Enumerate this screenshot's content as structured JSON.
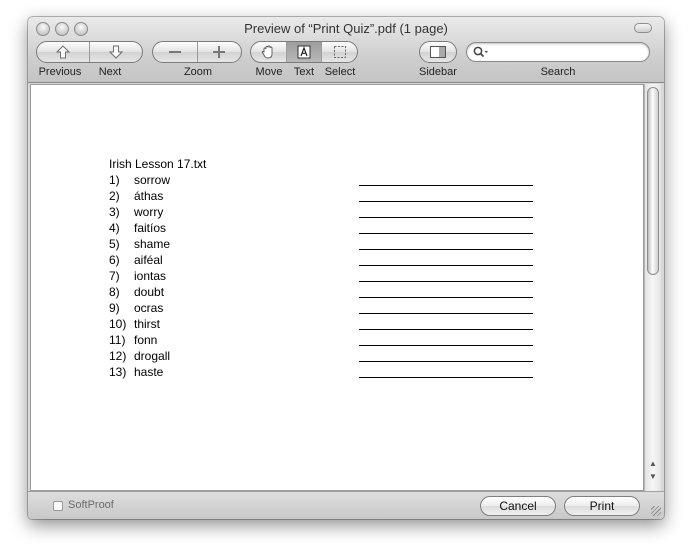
{
  "window": {
    "title": "Preview of “Print Quiz”.pdf (1 page)"
  },
  "toolbar": {
    "previous_label": "Previous",
    "next_label": "Next",
    "zoom_label": "Zoom",
    "move_label": "Move",
    "text_label": "Text",
    "select_label": "Select",
    "sidebar_label": "Sidebar",
    "search_label": "Search",
    "search_placeholder": "",
    "active_tool": "text"
  },
  "document": {
    "heading": "Irish Lesson 17.txt",
    "items": [
      {
        "num": "1)",
        "word": "sorrow"
      },
      {
        "num": "2)",
        "word": "áthas"
      },
      {
        "num": "3)",
        "word": "worry"
      },
      {
        "num": "4)",
        "word": "faitíos"
      },
      {
        "num": "5)",
        "word": "shame"
      },
      {
        "num": "6)",
        "word": "aiféal"
      },
      {
        "num": "7)",
        "word": "iontas"
      },
      {
        "num": "8)",
        "word": "doubt"
      },
      {
        "num": "9)",
        "word": "ocras"
      },
      {
        "num": "10)",
        "word": "thirst"
      },
      {
        "num": "11)",
        "word": "fonn"
      },
      {
        "num": "12)",
        "word": "drogall"
      },
      {
        "num": "13)",
        "word": "haste"
      }
    ]
  },
  "bottom": {
    "softproof_label": "SoftProof",
    "softproof_checked": false,
    "cancel_label": "Cancel",
    "print_label": "Print"
  }
}
